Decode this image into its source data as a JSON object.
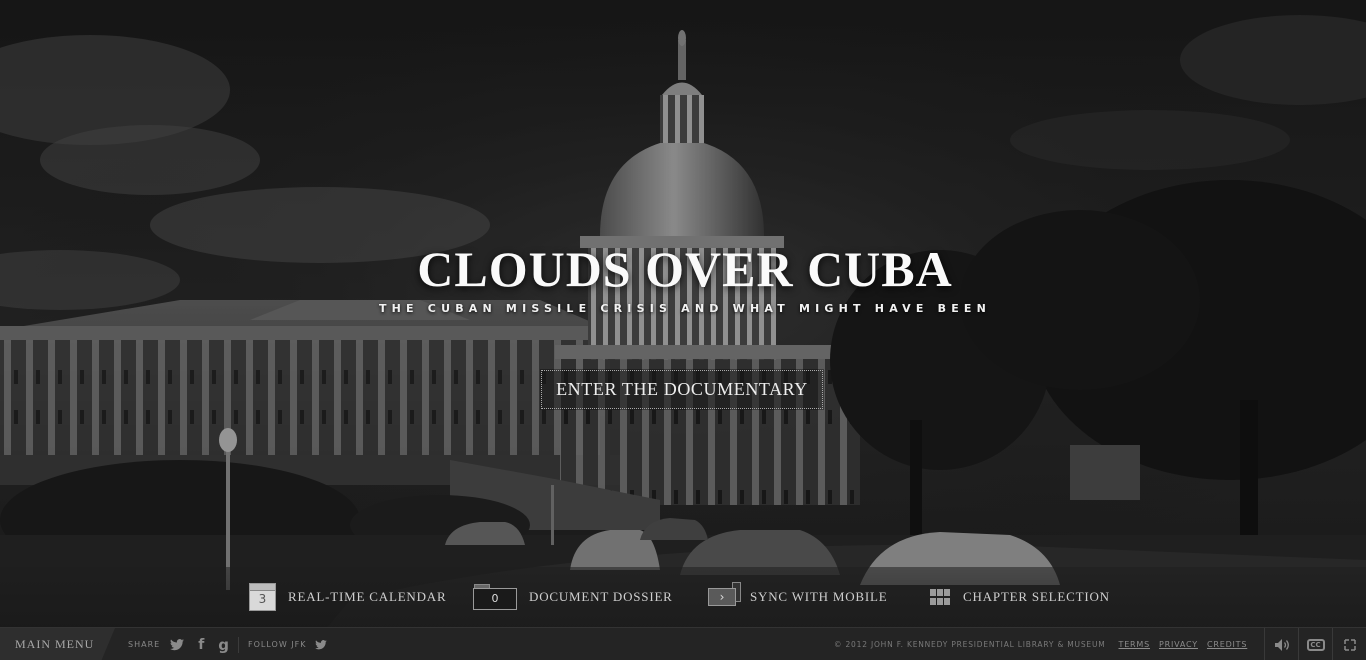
{
  "hero": {
    "title": "CLOUDS OVER CUBA",
    "subtitle": "THE CUBAN MISSILE CRISIS AND WHAT MIGHT HAVE BEEN",
    "enter_label": "ENTER THE DOCUMENTARY"
  },
  "features": [
    {
      "icon": "calendar-icon",
      "icon_value": "3",
      "label": "REAL-TIME CALENDAR"
    },
    {
      "icon": "folder-icon",
      "icon_value": "0",
      "label": "DOCUMENT DOSSIER"
    },
    {
      "icon": "sync-mobile-icon",
      "icon_value": "›",
      "label": "SYNC WITH MOBILE"
    },
    {
      "icon": "grid-icon",
      "label": "CHAPTER SELECTION"
    }
  ],
  "footer": {
    "main_menu": "MAIN MENU",
    "share_label": "SHARE",
    "follow_label": "FOLLOW JFK",
    "copyright": "© 2012 JOHN F. KENNEDY PRESIDENTIAL LIBRARY & MUSEUM",
    "links": [
      "TERMS",
      "PRIVACY",
      "CREDITS"
    ],
    "cc_label": "CC",
    "icons": [
      "twitter-icon",
      "facebook-icon",
      "google-icon",
      "sound-icon",
      "closed-captions-icon",
      "expand-icon"
    ]
  }
}
